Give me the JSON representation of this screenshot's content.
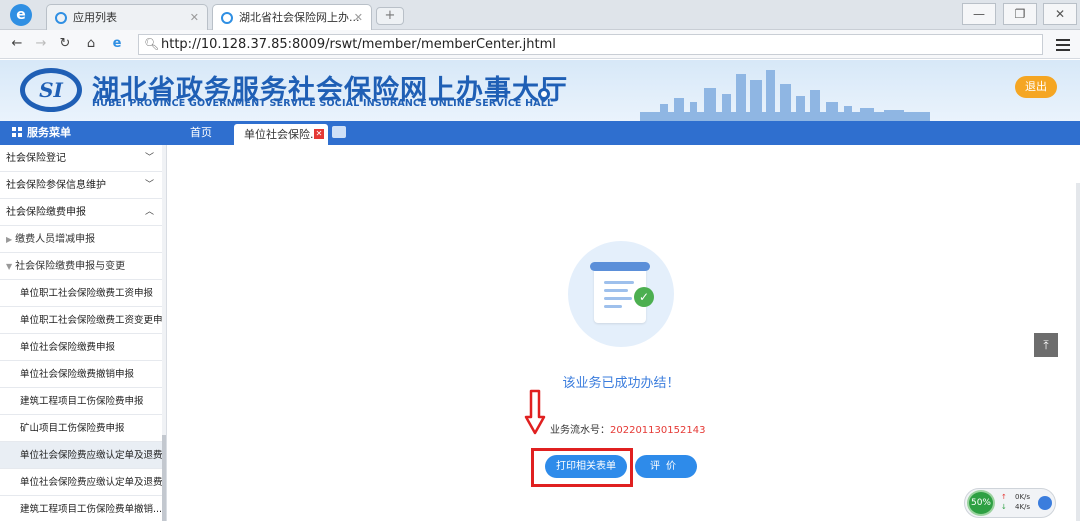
{
  "browser": {
    "tabs": [
      {
        "label": "应用列表"
      },
      {
        "label": "湖北省社会保险网上办..."
      }
    ],
    "url": "http://10.128.37.85:8009/rswt/member/memberCenter.jhtml"
  },
  "header": {
    "logo_text": "SI",
    "title": "湖北省政务服务社会保险网上办事大厅",
    "subtitle": "HUBEI PROVINCE GOVERNMENT SERVICE SOCIAL INSURANCE ONLINE SERVICE HALL",
    "logout": "退出"
  },
  "nav": {
    "menu_title": "服务菜单",
    "home_tab": "首页",
    "active_tab": "单位社会保险..."
  },
  "sidebar": {
    "items": [
      {
        "label": "社会保险登记"
      },
      {
        "label": "社会保险参保信息维护"
      },
      {
        "label": "社会保险缴费申报"
      },
      {
        "label": "缴费人员增减申报"
      },
      {
        "label": "社会保险缴费申报与变更"
      },
      {
        "label": "单位职工社会保险缴费工资申报"
      },
      {
        "label": "单位职工社会保险缴费工资变更申报"
      },
      {
        "label": "单位社会保险缴费申报"
      },
      {
        "label": "单位社会保险缴费撤销申报"
      },
      {
        "label": "建筑工程项目工伤保险费申报"
      },
      {
        "label": "矿山项目工伤保险费申报"
      },
      {
        "label": "单位社会保险费应缴认定单及退费单..."
      },
      {
        "label": "单位社会保险费应缴认定单及退费单..."
      },
      {
        "label": "建筑工程项目工伤保险费单撤销..."
      }
    ]
  },
  "main": {
    "success_message": "该业务已成功办结！",
    "serial_label": "业务流水号：",
    "serial_number": "202201130152143",
    "print_button": "打印相关表单",
    "rate_button": "评价"
  },
  "net_widget": {
    "percent": "50%",
    "up_speed": "0K/s",
    "down_speed": "4K/s"
  },
  "colors": {
    "brand_blue": "#1f5fb5",
    "nav_blue": "#2f6fcf",
    "button_blue": "#2e8bea",
    "highlight_red": "#e02020",
    "logout_orange": "#f5a623"
  }
}
